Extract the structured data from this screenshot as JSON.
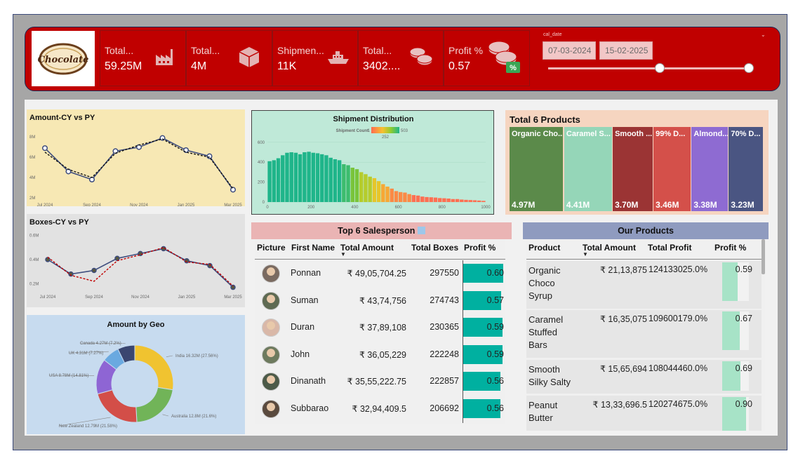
{
  "logo": {
    "text": "Chocolate"
  },
  "kpis": [
    {
      "label": "Total...",
      "value": "59.25M",
      "icon": "factory-icon"
    },
    {
      "label": "Total...",
      "value": "4M",
      "icon": "box-icon"
    },
    {
      "label": "Shipmen...",
      "value": "11K",
      "icon": "ship-icon"
    },
    {
      "label": "Total...",
      "value": "3402....",
      "icon": "coins-icon"
    },
    {
      "label": "Profit %",
      "value": "0.57",
      "icon": "coins-percent-icon"
    }
  ],
  "date_filter": {
    "label": "cal_date",
    "start": "07-03-2024",
    "end": "15-02-2025",
    "badge": "%"
  },
  "amount_chart": {
    "title": "Amount-CY vs PY",
    "chart_data": {
      "type": "line",
      "x": [
        "Jul 2024",
        "Aug 2024",
        "Sep 2024",
        "Oct 2024",
        "Nov 2024",
        "Dec 2024",
        "Jan 2025",
        "Feb 2025",
        "Mar 2025"
      ],
      "x_ticks": [
        "Jul 2024",
        "Sep 2024",
        "Nov 2024",
        "Jan 2025",
        "Mar 2025"
      ],
      "y_ticks": [
        "8M",
        "6M",
        "4M",
        "2M"
      ],
      "ylim": [
        2,
        8.5
      ],
      "series": [
        {
          "values": [
            6.9,
            4.6,
            3.8,
            6.6,
            7.0,
            7.9,
            6.7,
            6.1,
            2.8
          ],
          "style": "solid",
          "color": "#3e4d7e"
        },
        {
          "values": [
            6.5,
            4.8,
            4.0,
            6.4,
            7.2,
            7.8,
            6.5,
            6.0,
            2.9
          ],
          "style": "dashed",
          "color": "#111111"
        }
      ]
    }
  },
  "boxes_chart": {
    "title": "Boxes-CY vs PY",
    "chart_data": {
      "type": "line",
      "x": [
        "Jul 2024",
        "Aug 2024",
        "Sep 2024",
        "Oct 2024",
        "Nov 2024",
        "Dec 2024",
        "Jan 2025",
        "Feb 2025",
        "Mar 2025"
      ],
      "x_ticks": [
        "Jul 2024",
        "Sep 2024",
        "Nov 2024",
        "Jan 2025",
        "Mar 2025"
      ],
      "y_ticks": [
        "0.6M",
        "0.4M",
        "0.2M"
      ],
      "ylim": [
        0.15,
        0.65
      ],
      "series": [
        {
          "values": [
            0.4,
            0.28,
            0.31,
            0.41,
            0.45,
            0.49,
            0.39,
            0.35,
            0.17
          ],
          "style": "solid",
          "color": "#3e4d7e"
        },
        {
          "values": [
            0.42,
            0.27,
            0.22,
            0.39,
            0.44,
            0.5,
            0.38,
            0.36,
            0.18
          ],
          "style": "dashed",
          "color": "#c00000"
        }
      ]
    }
  },
  "geo_chart": {
    "title": "Amount by Geo",
    "chart_data": {
      "type": "pie",
      "slices": [
        {
          "name": "India",
          "label": "India 16.32M (27.56%)",
          "value": 16.32,
          "color": "#f0c330"
        },
        {
          "name": "Australia",
          "label": "Australia 12.8M (21.6%)",
          "value": 12.8,
          "color": "#71b458"
        },
        {
          "name": "New Zealand",
          "label": "New Zealand 12.79M (21.58%)",
          "value": 12.79,
          "color": "#d34e48"
        },
        {
          "name": "USA",
          "label": "USA 8.78M (14.81%)",
          "value": 8.78,
          "color": "#8e65d4"
        },
        {
          "name": "UK",
          "label": "UK 4.31M (7.27%)",
          "value": 4.31,
          "color": "#6aa9e0"
        },
        {
          "name": "Canada",
          "label": "Canada 4.27M (7.2%)",
          "value": 4.27,
          "color": "#3a4670"
        }
      ]
    }
  },
  "shipment_chart": {
    "title": "Shipment Distribution",
    "legend_label": "Shipment Count",
    "legend_min": "1",
    "legend_mid": "252",
    "legend_max": "503",
    "chart_data": {
      "type": "bar",
      "x_ticks": [
        "0",
        "200",
        "400",
        "600",
        "800",
        "1000"
      ],
      "y_ticks": [
        "600",
        "400",
        "200",
        "0"
      ],
      "xlim": [
        0,
        1000
      ],
      "ylim": [
        0,
        620
      ],
      "bin_width": 20,
      "values": [
        410,
        420,
        440,
        470,
        495,
        500,
        495,
        480,
        500,
        505,
        495,
        490,
        480,
        470,
        445,
        430,
        420,
        380,
        370,
        345,
        330,
        300,
        280,
        255,
        240,
        210,
        180,
        155,
        135,
        110,
        100,
        95,
        80,
        70,
        65,
        55,
        50,
        48,
        45,
        40,
        38,
        35,
        30,
        30,
        25,
        22,
        20,
        18,
        15,
        12
      ]
    }
  },
  "top_products": {
    "title": "Total 6 Products",
    "items": [
      {
        "name": "Organic Cho...",
        "value": "4.97M",
        "color": "#5b8a4a"
      },
      {
        "name": "Caramel S...",
        "value": "4.41M",
        "color": "#95d6b8"
      },
      {
        "name": "Smooth ...",
        "value": "3.70M",
        "color": "#9b3434"
      },
      {
        "name": "99% D...",
        "value": "3.46M",
        "color": "#d4504a"
      },
      {
        "name": "Almond...",
        "value": "3.38M",
        "color": "#8e6bd2"
      },
      {
        "name": "70% D...",
        "value": "3.23M",
        "color": "#4a5582"
      }
    ]
  },
  "salesperson": {
    "title": "Top 6 Salesperson",
    "columns": [
      "Picture",
      "First Name",
      "Total Amount",
      "Total Boxes",
      "Profit %"
    ],
    "rows": [
      {
        "name": "Ponnan",
        "amount": "₹ 49,05,704.25",
        "boxes": "297550",
        "profit": "0.60",
        "pct": 0.6
      },
      {
        "name": "Suman",
        "amount": "₹ 43,74,756",
        "boxes": "274743",
        "profit": "0.57",
        "pct": 0.57
      },
      {
        "name": "Duran",
        "amount": "₹ 37,89,108",
        "boxes": "230365",
        "profit": "0.59",
        "pct": 0.59
      },
      {
        "name": "John",
        "amount": "₹ 36,05,229",
        "boxes": "222248",
        "profit": "0.59",
        "pct": 0.59
      },
      {
        "name": "Dinanath",
        "amount": "₹ 35,55,222.75",
        "boxes": "222857",
        "profit": "0.56",
        "pct": 0.56
      },
      {
        "name": "Subbarao",
        "amount": "₹ 32,94,409.5",
        "boxes": "206692",
        "profit": "0.56",
        "pct": 0.56
      }
    ]
  },
  "our_products": {
    "title": "Our Products",
    "columns": [
      "Product",
      "Total Amount",
      "Total Profit",
      "Profit %"
    ],
    "rows": [
      {
        "product": [
          "Organic",
          "Choco",
          "Syrup"
        ],
        "amount": "₹ 21,13,875",
        "profit": "124133025.0%",
        "pct_label": "0.59",
        "pct": 0.59
      },
      {
        "product": [
          "Caramel",
          "Stuffed",
          "Bars"
        ],
        "amount": "₹ 16,35,075",
        "profit": "109600179.0%",
        "pct_label": "0.67",
        "pct": 0.67
      },
      {
        "product": [
          "Smooth",
          "Silky Salty"
        ],
        "amount": "₹ 15,65,694",
        "profit": "108044460.0%",
        "pct_label": "0.69",
        "pct": 0.69
      },
      {
        "product": [
          "Peanut",
          "Butter"
        ],
        "amount": "₹ 13,33,696.5",
        "profit": "120274675.0%",
        "pct_label": "0.90",
        "pct": 0.9
      }
    ]
  }
}
